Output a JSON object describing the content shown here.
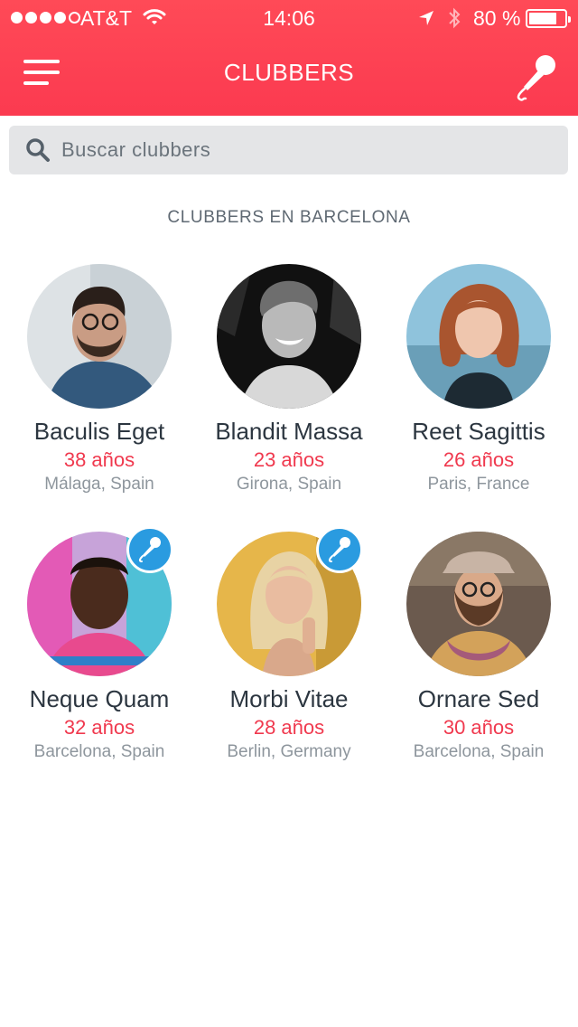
{
  "status_bar": {
    "carrier": "AT&T",
    "time": "14:06",
    "battery": "80 %",
    "battery_level": 0.8
  },
  "header": {
    "title": "CLUBBERS",
    "menu_icon": "hamburger-menu-icon",
    "mic_icon": "microphone-icon"
  },
  "search": {
    "placeholder": "Buscar clubbers"
  },
  "section_title": "CLUBBERS EN BARCELONA",
  "colors": {
    "header": "#fb3a50",
    "age": "#f0394e",
    "badge": "#2a9be0"
  },
  "clubbers": [
    {
      "name": "Baculis Eget",
      "age": "38 años",
      "location": "Málaga, Spain",
      "has_mic": false
    },
    {
      "name": "Blandit Massa",
      "age": "23 años",
      "location": "Girona, Spain",
      "has_mic": false
    },
    {
      "name": "Reet Sagittis",
      "age": "26 años",
      "location": "Paris, France",
      "has_mic": false
    },
    {
      "name": "Neque Quam",
      "age": "32 años",
      "location": "Barcelona, Spain",
      "has_mic": true
    },
    {
      "name": "Morbi Vitae",
      "age": "28 años",
      "location": "Berlin, Germany",
      "has_mic": true
    },
    {
      "name": "Ornare Sed",
      "age": "30 años",
      "location": "Barcelona, Spain",
      "has_mic": false
    }
  ]
}
